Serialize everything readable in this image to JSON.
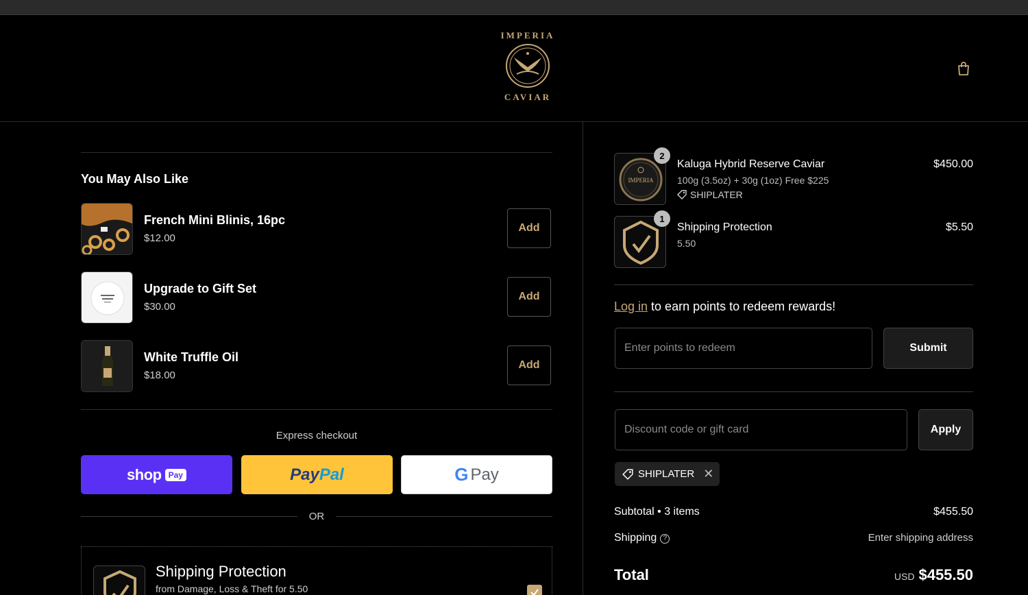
{
  "brand": {
    "logo_top": "IMPERIA",
    "logo_bottom": "CAVIAR",
    "accent_color": "#c7a875"
  },
  "upsells": {
    "title": "You May Also Like",
    "items": [
      {
        "name": "French Mini Blinis, 16pc",
        "price": "$12.00",
        "button": "Add"
      },
      {
        "name": "Upgrade to Gift Set",
        "price": "$30.00",
        "button": "Add"
      },
      {
        "name": "White Truffle Oil",
        "price": "$18.00",
        "button": "Add"
      }
    ]
  },
  "express": {
    "label": "Express checkout",
    "shop_pay": {
      "word": "shop",
      "chip": "Pay",
      "color": "#5a31f4"
    },
    "paypal": {
      "part1": "Pay",
      "part2": "Pal",
      "color": "#ffc439"
    },
    "gpay": {
      "g": "G",
      "word": "Pay"
    },
    "or": "OR"
  },
  "protection_offer": {
    "title": "Shipping Protection",
    "subtitle": "from Damage, Loss & Theft for 5.50",
    "checked": true
  },
  "order": {
    "items": [
      {
        "qty": "2",
        "title": "Kaluga Hybrid Reserve Caviar",
        "variant": "100g (3.5oz) + 30g (1oz) Free $225",
        "discount_tag": "SHIPLATER",
        "price": "$450.00",
        "thumb_text": "IMPERIA"
      },
      {
        "qty": "1",
        "title": "Shipping Protection",
        "variant": "5.50",
        "price": "$5.50"
      }
    ]
  },
  "loyalty": {
    "link": "Log in",
    "text": " to earn points to redeem rewards!",
    "input_placeholder": "Enter points to redeem",
    "submit": "Submit"
  },
  "discount": {
    "input_placeholder": "Discount code or gift card",
    "apply": "Apply",
    "applied_code": "SHIPLATER"
  },
  "summary": {
    "subtotal_label": "Subtotal • 3 items",
    "subtotal_value": "$455.50",
    "shipping_label": "Shipping",
    "shipping_value": "Enter shipping address",
    "total_label": "Total",
    "currency": "USD",
    "total_value": "$455.50"
  }
}
